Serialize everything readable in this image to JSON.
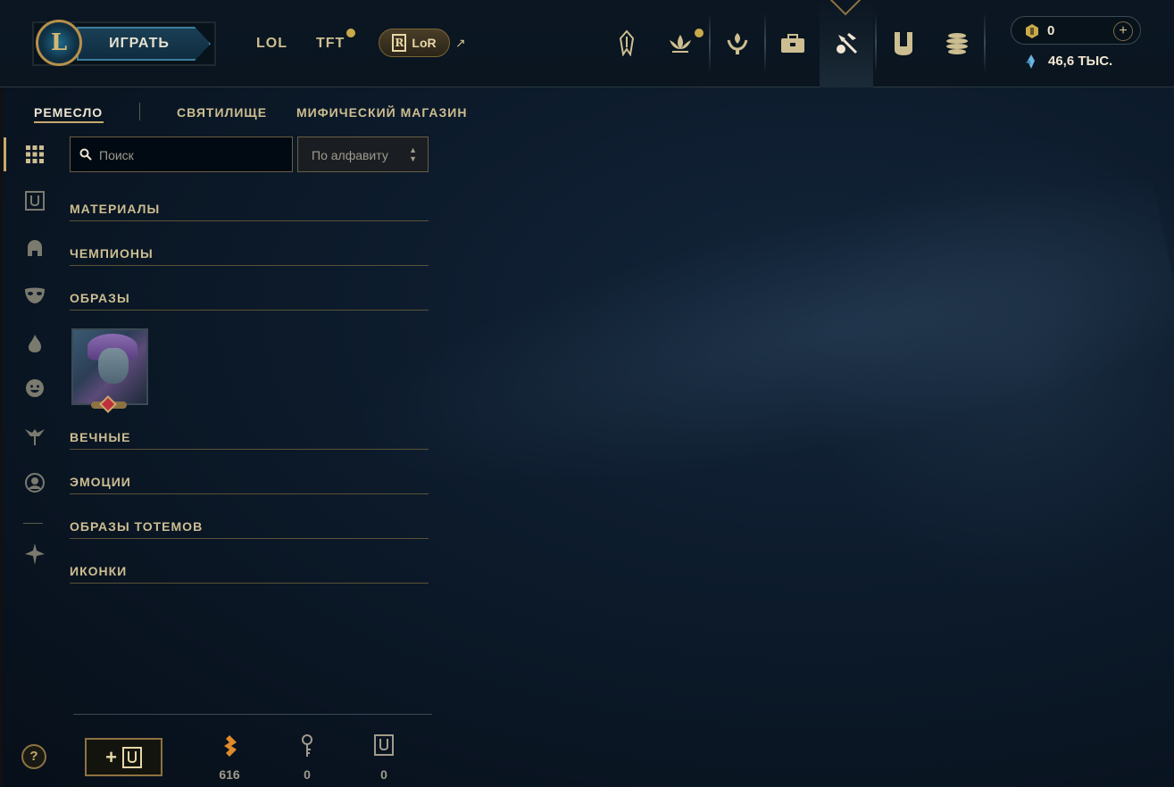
{
  "header": {
    "logo_text": "L",
    "play_label": "ИГРАТЬ",
    "game_tabs": [
      {
        "label": "LOL",
        "has_notification": false
      },
      {
        "label": "TFT",
        "has_notification": true
      }
    ],
    "lor_label": "LoR",
    "lor_badge": "R",
    "external_arrow": "↗",
    "nav_icons": [
      {
        "name": "champions-icon"
      },
      {
        "name": "lotus-icon",
        "has_notification": true
      },
      {
        "name": "honor-icon"
      },
      {
        "name": "collection-icon"
      },
      {
        "name": "crafting-icon",
        "active": true
      },
      {
        "name": "hextech-chest-icon"
      },
      {
        "name": "store-icon"
      }
    ],
    "rp_value": "0",
    "plus_label": "+",
    "be_value": "46,6 ТЫС."
  },
  "subtabs": {
    "crafting": "РЕМЕСЛО",
    "sanctum": "СВЯТИЛИЩЕ",
    "mythic_shop": "МИФИЧЕСКИЙ МАГАЗИН"
  },
  "search": {
    "placeholder": "Поиск",
    "value": ""
  },
  "sort": {
    "label": "По алфавиту"
  },
  "sections": {
    "materials": "МАТЕРИАЛЫ",
    "champions": "ЧЕМПИОНЫ",
    "skins": "ОБРАЗЫ",
    "eternals": "ВЕЧНЫЕ",
    "emotes": "ЭМОЦИИ",
    "ward_skins": "ОБРАЗЫ ТОТЕМОВ",
    "icons": "ИКОНКИ"
  },
  "footer": {
    "help_label": "?",
    "add_chest_plus": "+",
    "orange_essence": "616",
    "keys": "0",
    "chests": "0"
  },
  "colors": {
    "gold": "#c8aa6e",
    "text": "#cdbe91",
    "accent_blue": "#3d7f9e",
    "notification": "#c8aa4c"
  }
}
